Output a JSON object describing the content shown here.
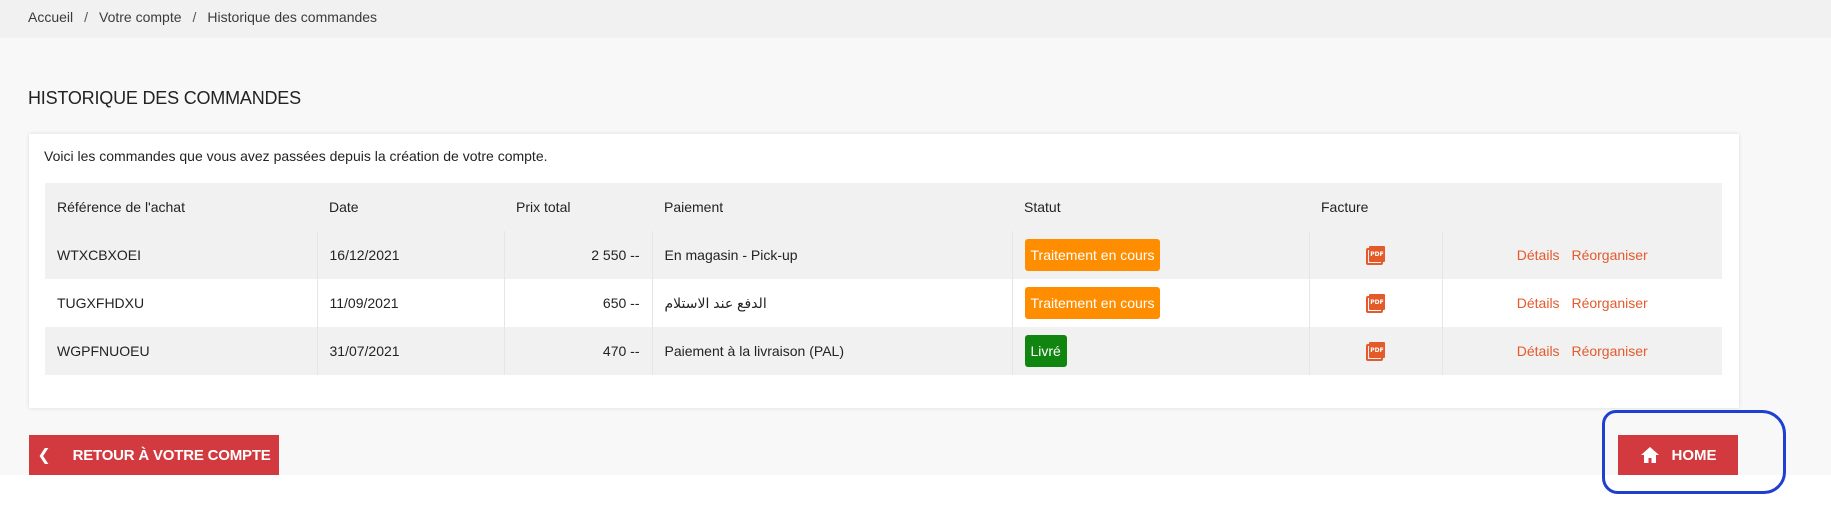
{
  "breadcrumb": {
    "items": [
      "Accueil",
      "Votre compte",
      "Historique des commandes"
    ],
    "separator": "/"
  },
  "page": {
    "title": "HISTORIQUE DES COMMANDES",
    "intro": "Voici les commandes que vous avez passées depuis la création de votre compte."
  },
  "table": {
    "headers": [
      "Référence de l'achat",
      "Date",
      "Prix total",
      "Paiement",
      "Statut",
      "Facture",
      ""
    ],
    "rows": [
      {
        "reference": "WTXCBXOEI",
        "date": "16/12/2021",
        "total": "2 550 --",
        "payment": "En magasin - Pick-up",
        "status": "Traitement en cours",
        "status_color": "#ff8d00",
        "invoice_icon": "pdf-icon",
        "details": "Détails",
        "reorder": "Réorganiser"
      },
      {
        "reference": "TUGXFHDXU",
        "date": "11/09/2021",
        "total": "650 --",
        "payment": "الدفع عند الاستلام",
        "status": "Traitement en cours",
        "status_color": "#ff8d00",
        "invoice_icon": "pdf-icon",
        "details": "Détails",
        "reorder": "Réorganiser"
      },
      {
        "reference": "WGPFNUOEU",
        "date": "31/07/2021",
        "total": "470 --",
        "payment": "Paiement à la livraison (PAL)",
        "status": "Livré",
        "status_color": "#108510",
        "invoice_icon": "pdf-icon",
        "details": "Détails",
        "reorder": "Réorganiser"
      }
    ]
  },
  "buttons": {
    "back_label": "RETOUR À VOTRE COMPTE",
    "back_icon": "chevron-left-icon",
    "home_label": "HOME",
    "home_icon": "home-icon"
  },
  "colors": {
    "accent": "#d33a3f",
    "link": "#e45a2b",
    "annotation": "#1f3fd1"
  }
}
